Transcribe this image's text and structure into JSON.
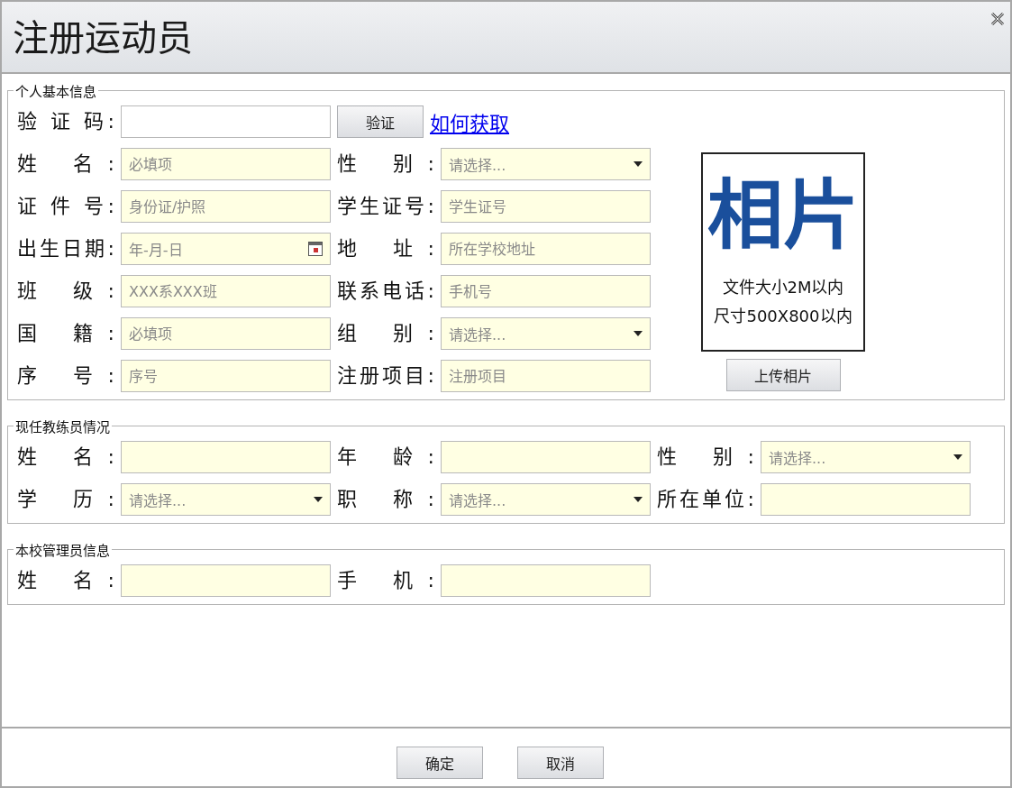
{
  "window": {
    "title": "注册运动员"
  },
  "sections": [
    {
      "legend": "个人基本信息",
      "captcha": {
        "label": "验 证 码:",
        "button": "验证",
        "link": "如何获取"
      },
      "rows": [
        [
          {
            "label": "姓 名:",
            "kind": "text",
            "placeholder": "必填项"
          },
          {
            "label": "性 别:",
            "kind": "select",
            "placeholder": "请选择..."
          }
        ],
        [
          {
            "label": "证 件 号:",
            "kind": "text",
            "placeholder": "身份证/护照"
          },
          {
            "label": "学生证号:",
            "kind": "text",
            "placeholder": "学生证号"
          }
        ],
        [
          {
            "label": "出生日期:",
            "kind": "date",
            "placeholder": "年-月-日"
          },
          {
            "label": "地 址:",
            "kind": "text",
            "placeholder": "所在学校地址"
          }
        ],
        [
          {
            "label": "班 级:",
            "kind": "text",
            "placeholder": "XXX系XXX班"
          },
          {
            "label": "联系电话:",
            "kind": "text",
            "placeholder": "手机号"
          }
        ],
        [
          {
            "label": "国 籍:",
            "kind": "text",
            "placeholder": "必填项"
          },
          {
            "label": "组 别:",
            "kind": "select",
            "placeholder": "请选择..."
          }
        ],
        [
          {
            "label": "序 号:",
            "kind": "text",
            "placeholder": "序号"
          },
          {
            "label": "注册项目:",
            "kind": "text",
            "placeholder": "注册项目"
          }
        ]
      ],
      "photo": {
        "heading": "相片",
        "lines": [
          "文件大小2M以内",
          "尺寸500X800以内"
        ],
        "button": "上传相片"
      }
    },
    {
      "legend": "现任教练员情况",
      "rows": [
        [
          {
            "label": "姓 名:",
            "kind": "text"
          },
          {
            "label": "年 龄:",
            "kind": "text"
          },
          {
            "label": "性 别:",
            "kind": "select",
            "placeholder": "请选择..."
          }
        ],
        [
          {
            "label": "学 历:",
            "kind": "select",
            "placeholder": "请选择..."
          },
          {
            "label": "职 称:",
            "kind": "select",
            "placeholder": "请选择..."
          },
          {
            "label": "所在单位:",
            "kind": "text"
          }
        ]
      ]
    },
    {
      "legend": "本校管理员信息",
      "rows": [
        [
          {
            "label": "姓 名:",
            "kind": "text"
          },
          {
            "label": "手 机:",
            "kind": "text"
          }
        ]
      ]
    }
  ],
  "buttons": [
    {
      "label": "确定"
    },
    {
      "label": "取消"
    }
  ]
}
